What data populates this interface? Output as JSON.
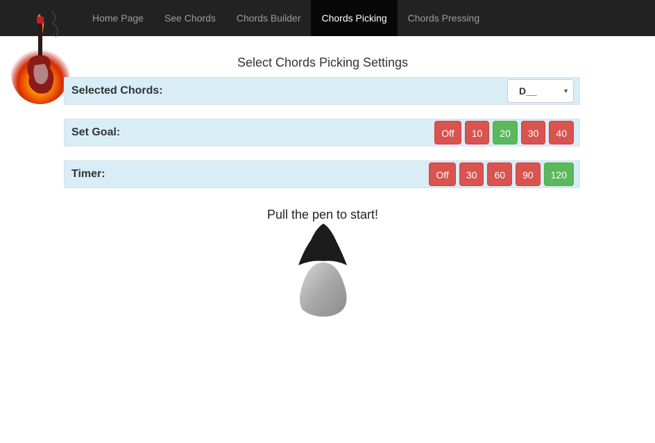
{
  "nav": {
    "items": [
      {
        "label": "Home Page",
        "active": false
      },
      {
        "label": "See Chords",
        "active": false
      },
      {
        "label": "Chords Builder",
        "active": false
      },
      {
        "label": "Chords Picking",
        "active": true
      },
      {
        "label": "Chords Pressing",
        "active": false
      }
    ],
    "logo_icon": "flaming-guitar-logo"
  },
  "page": {
    "title": "Select Chords Picking Settings",
    "settings": {
      "chords": {
        "label": "Selected Chords:",
        "selected": "D__"
      },
      "goal": {
        "label": "Set Goal:",
        "options": [
          {
            "label": "Off",
            "color": "#d9534f"
          },
          {
            "label": "10",
            "color": "#d9534f"
          },
          {
            "label": "20",
            "color": "#5cb85c",
            "selected": true
          },
          {
            "label": "30",
            "color": "#d9534f"
          },
          {
            "label": "40",
            "color": "#d9534f"
          }
        ]
      },
      "timer": {
        "label": "Timer:",
        "options": [
          {
            "label": "Off",
            "color": "#d9534f"
          },
          {
            "label": "30",
            "color": "#d9534f"
          },
          {
            "label": "60",
            "color": "#d9534f"
          },
          {
            "label": "90",
            "color": "#d9534f"
          },
          {
            "label": "120",
            "color": "#5cb85c",
            "selected": true
          }
        ]
      }
    },
    "prompt": "Pull the pen to start!"
  }
}
